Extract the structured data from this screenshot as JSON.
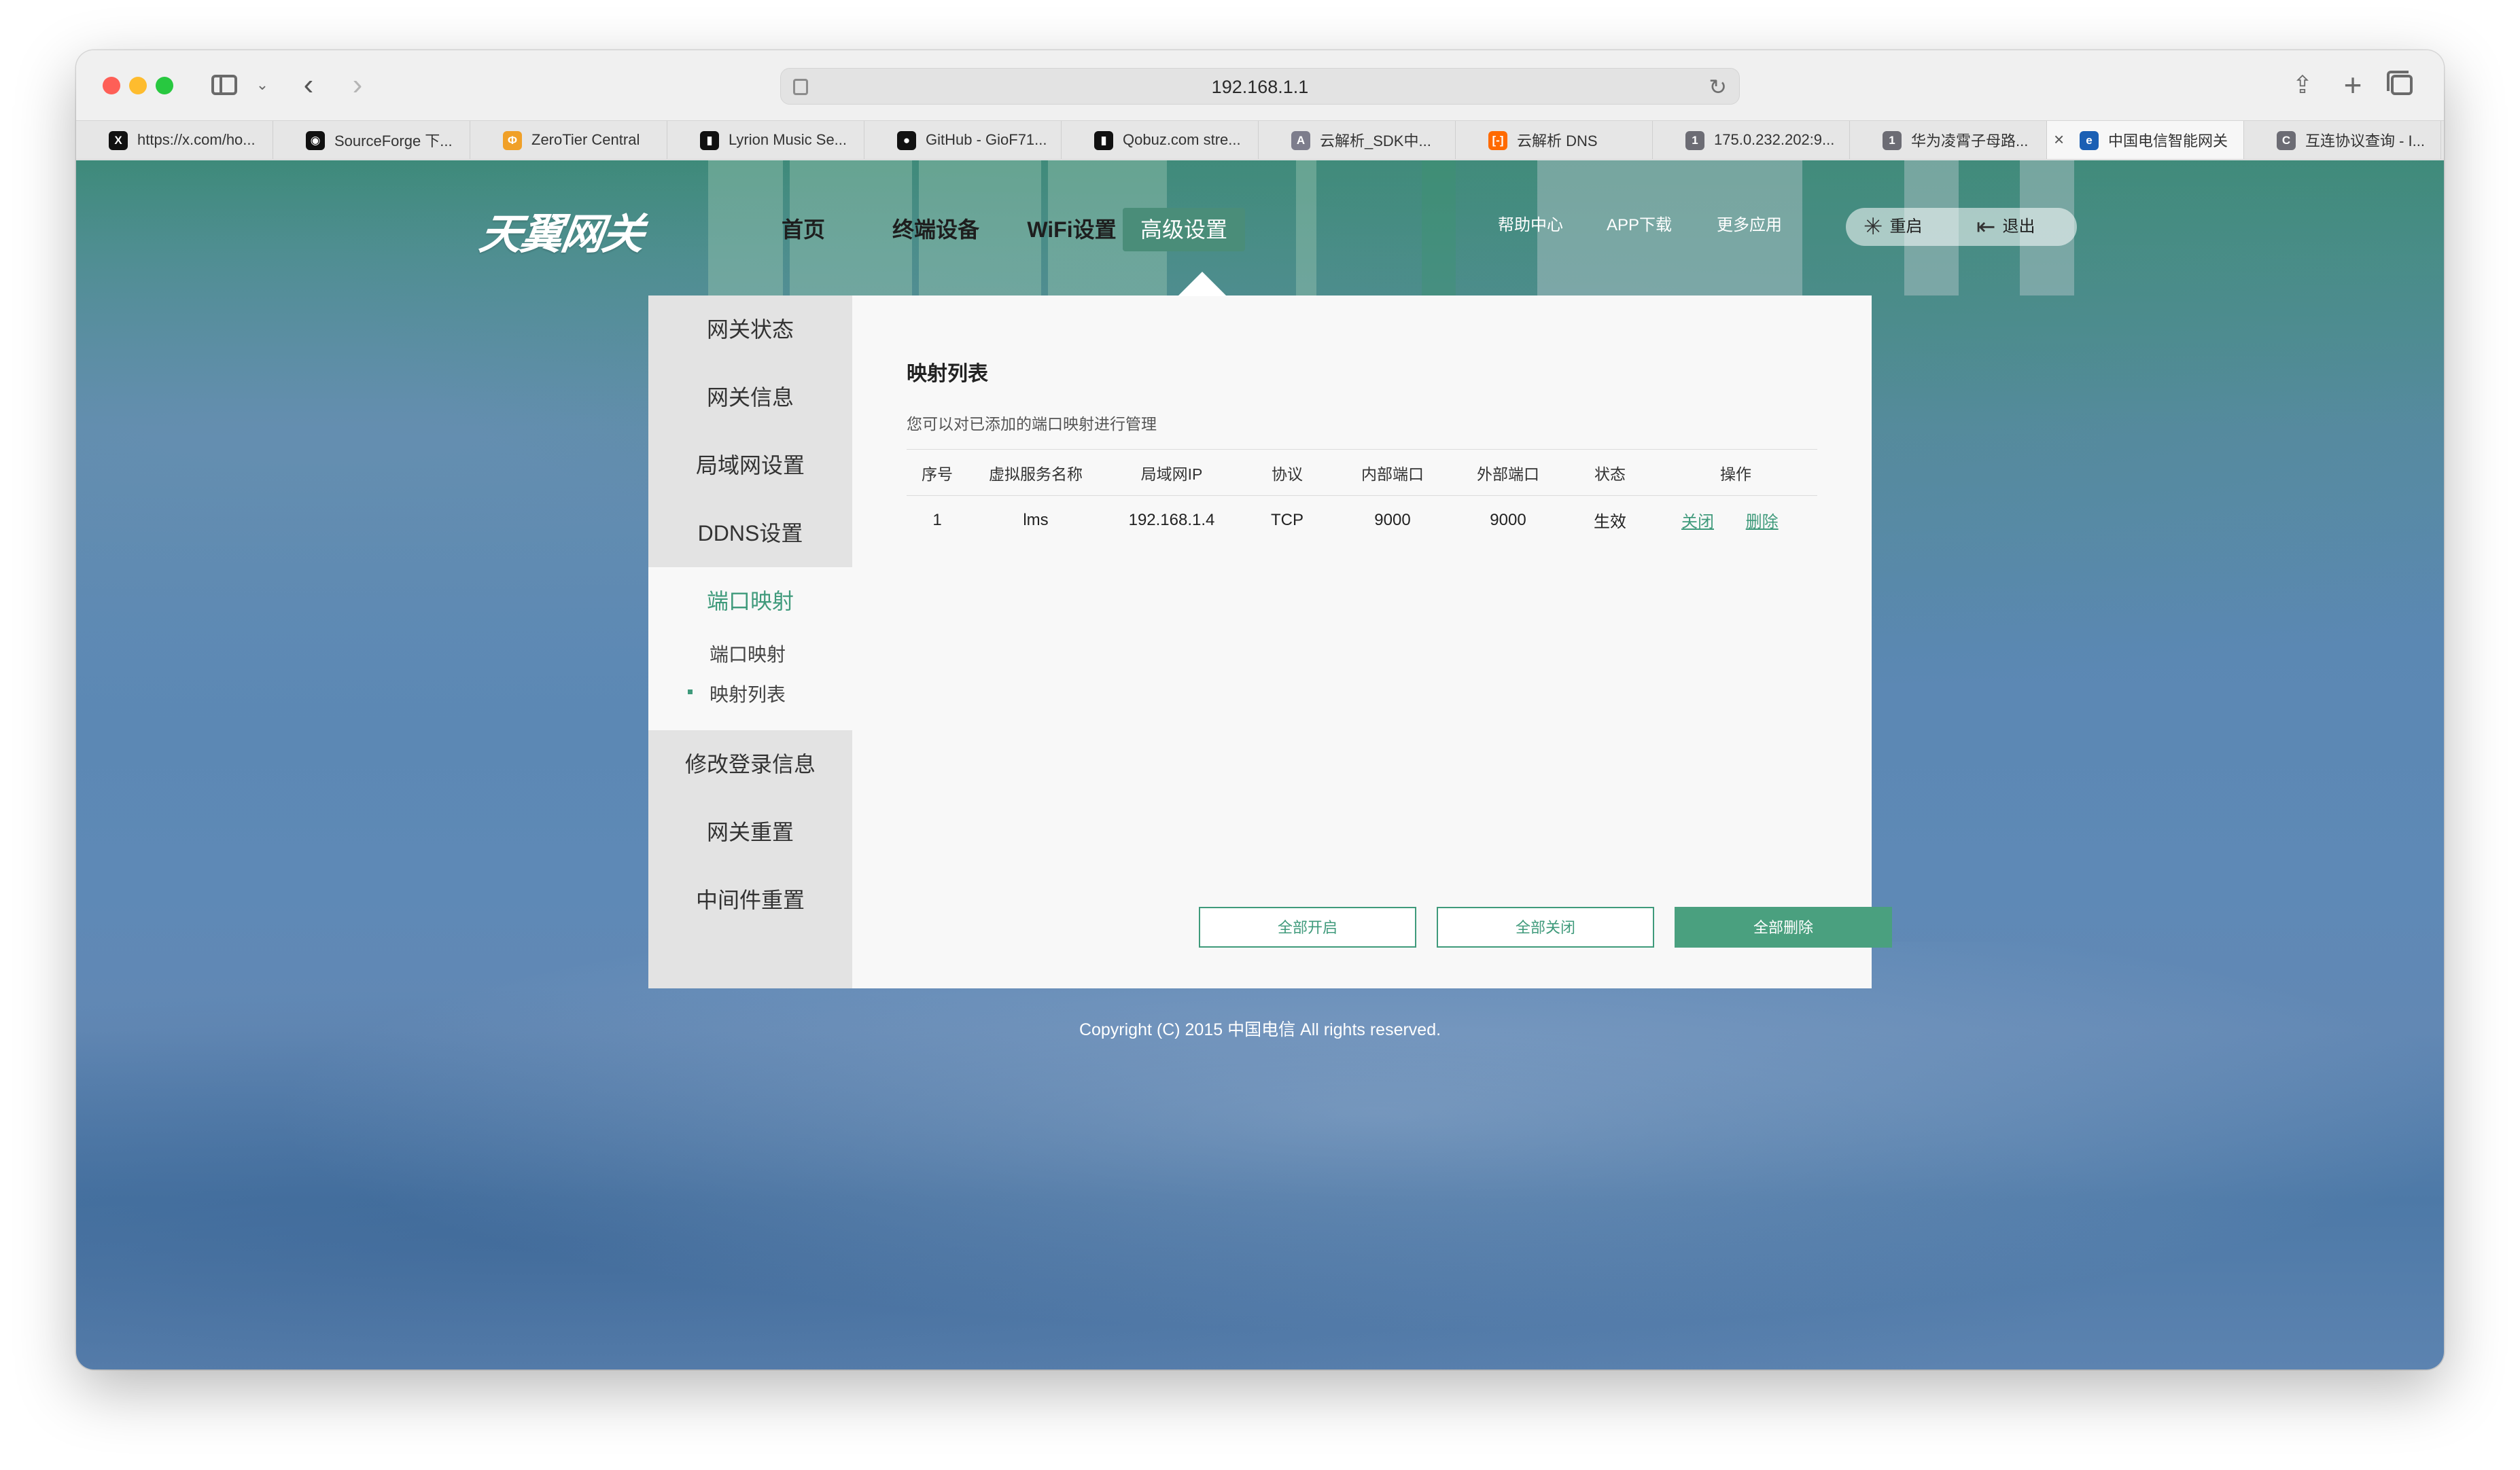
{
  "browser": {
    "address": "192.168.1.1",
    "tabs": [
      {
        "label": "https://x.com/ho...",
        "icon": "x-logo-icon",
        "color": "#111111",
        "glyph": "X"
      },
      {
        "label": "SourceForge 下...",
        "icon": "sourceforge-icon",
        "color": "#111111",
        "glyph": "◉"
      },
      {
        "label": "ZeroTier Central",
        "icon": "zerotier-icon",
        "color": "#f0a028",
        "glyph": "Φ"
      },
      {
        "label": "Lyrion Music Se...",
        "icon": "lyrion-icon",
        "color": "#111111",
        "glyph": "▮"
      },
      {
        "label": "GitHub - GioF71...",
        "icon": "github-icon",
        "color": "#111111",
        "glyph": "●"
      },
      {
        "label": "Qobuz.com stre...",
        "icon": "qobuz-icon",
        "color": "#111111",
        "glyph": "▮"
      },
      {
        "label": "云解析_SDK中...",
        "icon": "aliyun-a-icon",
        "color": "#7d7d8c",
        "glyph": "A"
      },
      {
        "label": "云解析 DNS",
        "icon": "aliyun-cloud-icon",
        "color": "#ff6a00",
        "glyph": "[-]"
      },
      {
        "label": "175.0.232.202:9...",
        "icon": "number-one-icon",
        "color": "#6c6c74",
        "glyph": "1"
      },
      {
        "label": "华为凌霄子母路...",
        "icon": "number-one-icon",
        "color": "#6c6c74",
        "glyph": "1"
      },
      {
        "label": "中国电信智能网关",
        "icon": "china-telecom-icon",
        "color": "#1a5fb4",
        "glyph": "e",
        "active": true
      },
      {
        "label": "互连协议查询 - I...",
        "icon": "letter-c-icon",
        "color": "#6c6c74",
        "glyph": "C"
      }
    ]
  },
  "header": {
    "logo": "天翼网关",
    "nav": [
      "首页",
      "终端设备",
      "WiFi设置",
      "高级设置"
    ],
    "links": [
      "帮助中心",
      "APP下载",
      "更多应用"
    ],
    "restart": "重启",
    "logout": "退出"
  },
  "sidebar": {
    "items": [
      "网关状态",
      "网关信息",
      "局域网设置",
      "DDNS设置",
      "端口映射",
      "修改登录信息",
      "网关重置",
      "中间件重置"
    ],
    "sub": [
      "端口映射",
      "映射列表"
    ]
  },
  "main": {
    "title": "映射列表",
    "desc": "您可以对已添加的端口映射进行管理",
    "columns": [
      "序号",
      "虚拟服务名称",
      "局域网IP",
      "协议",
      "内部端口",
      "外部端口",
      "状态",
      "操作"
    ],
    "rows": [
      {
        "no": "1",
        "name": "lms",
        "ip": "192.168.1.4",
        "proto": "TCP",
        "in": "9000",
        "out": "9000",
        "status": "生效",
        "a1": "关闭",
        "a2": "删除"
      }
    ],
    "buttons": [
      "全部开启",
      "全部关闭",
      "全部删除"
    ]
  },
  "footer": "Copyright (C) 2015 中国电信 All rights reserved.",
  "colors": {
    "accent": "#3f9a7b",
    "nav_active": "#4a8d79"
  }
}
